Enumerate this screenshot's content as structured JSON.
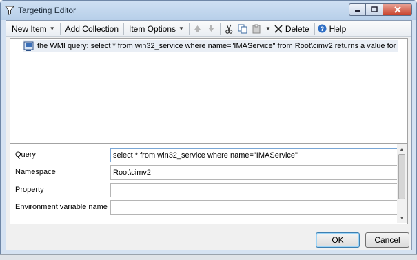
{
  "window": {
    "title": "Targeting Editor"
  },
  "toolbar": {
    "new_item": "New Item",
    "add_collection": "Add Collection",
    "item_options": "Item Options",
    "delete": "Delete",
    "help": "Help"
  },
  "tree": {
    "items": [
      {
        "label": "the WMI query: select * from win32_service where name=\"IMAService\" from Root\\cimv2 returns a value for",
        "icon": "wmi-query-icon"
      }
    ]
  },
  "properties": {
    "rows": [
      {
        "label": "Query",
        "value": "select * from win32_service where name=\"IMAService\""
      },
      {
        "label": "Namespace",
        "value": "Root\\cimv2"
      },
      {
        "label": "Property",
        "value": ""
      },
      {
        "label": "Environment variable name",
        "value": ""
      }
    ]
  },
  "buttons": {
    "ok": "OK",
    "cancel": "Cancel"
  },
  "colors": {
    "title_bar": "#b7cfe9",
    "close_button": "#c8432d",
    "selection": "#e9eef5",
    "focus_border": "#7aa7d6"
  }
}
